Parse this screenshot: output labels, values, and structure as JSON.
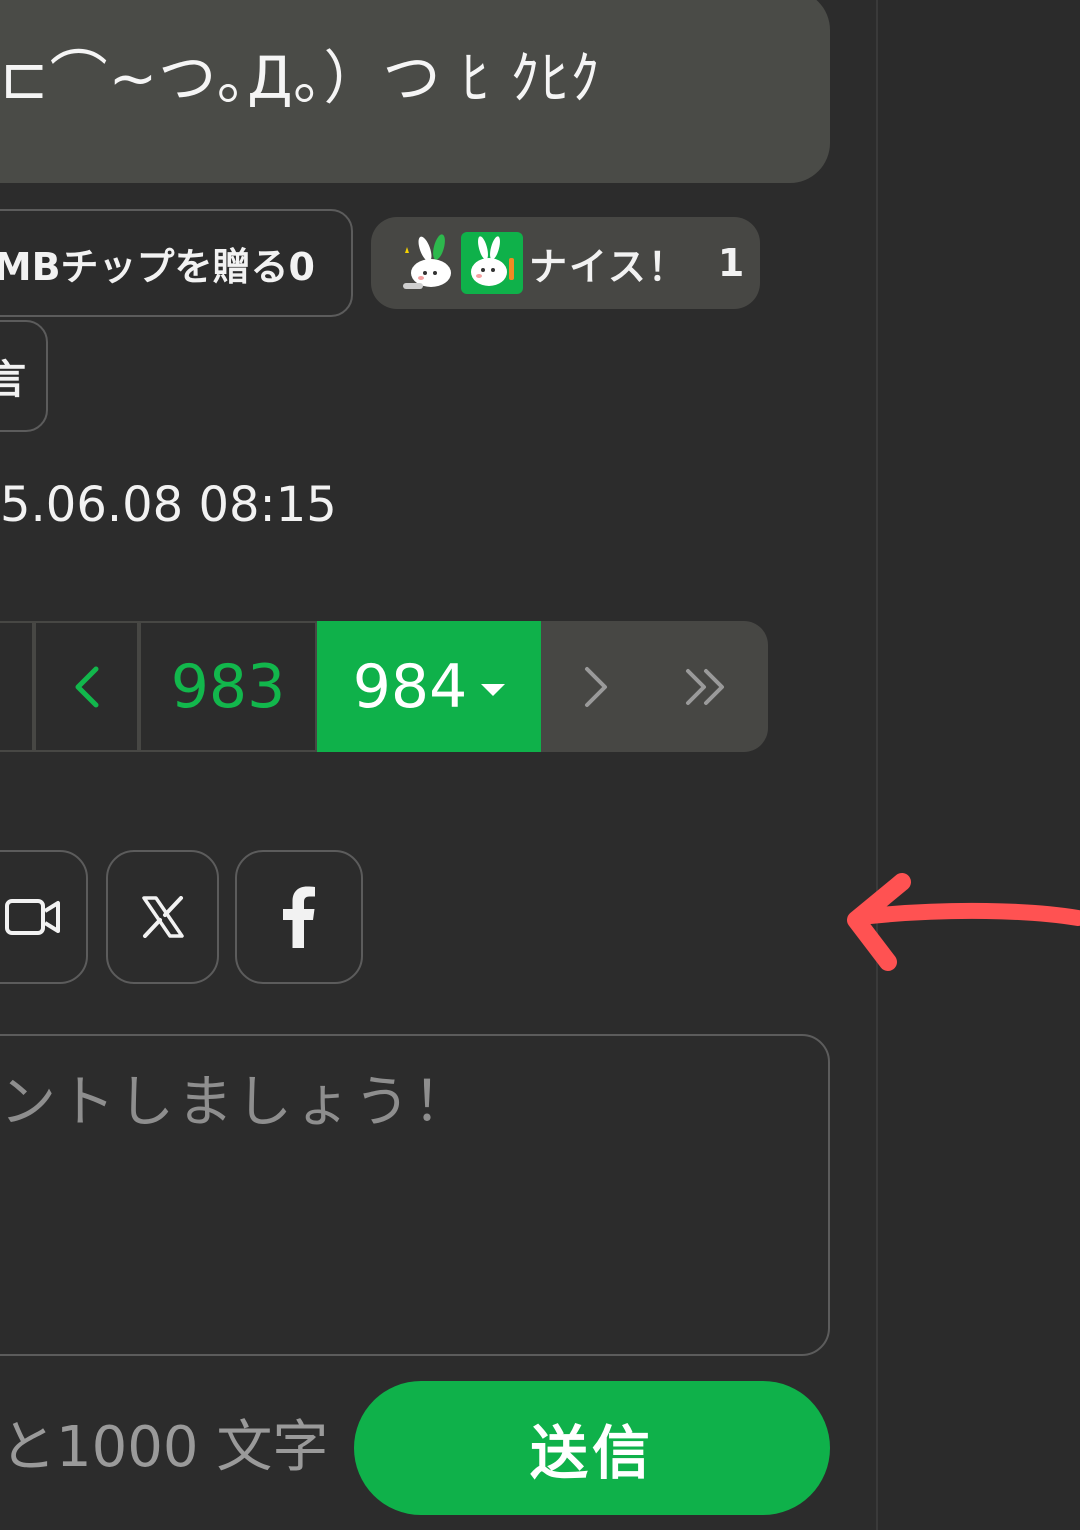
{
  "comment": {
    "text": "⊏⌒~つ｡Д｡）つ ﾋ ｸﾋｸ"
  },
  "reactions": {
    "tip_label": "MBチップを贈る0",
    "nice_label": "ナイス！",
    "nice_count": "1",
    "reply_label": "言"
  },
  "timestamp": "5.06.08 08:15",
  "pagination": {
    "prev_page": "983",
    "current_page": "984",
    "prev_icon": "chevron-left-icon",
    "next_icon": "chevron-right-icon",
    "last_icon": "double-chevron-right-icon"
  },
  "share": {
    "icons": [
      "video-icon",
      "x-logo-icon",
      "facebook-icon"
    ]
  },
  "comment_form": {
    "placeholder": "ントしましょう！",
    "remaining": "と1000 文字",
    "send_label": "送信"
  },
  "colors": {
    "accent_green": "#0fb14a",
    "background": "#2c2c2c",
    "annotation_arrow": "#ff5252"
  }
}
